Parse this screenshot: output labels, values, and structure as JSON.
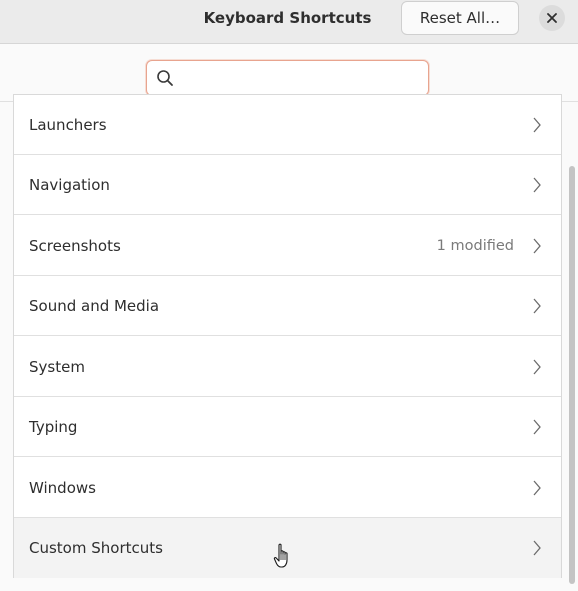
{
  "window": {
    "title": "Keyboard Shortcuts",
    "reset_label": "Reset All…"
  },
  "search": {
    "placeholder": "",
    "value": ""
  },
  "categories": [
    {
      "label": "Launchers",
      "status": ""
    },
    {
      "label": "Navigation",
      "status": ""
    },
    {
      "label": "Screenshots",
      "status": "1 modified"
    },
    {
      "label": "Sound and Media",
      "status": ""
    },
    {
      "label": "System",
      "status": ""
    },
    {
      "label": "Typing",
      "status": ""
    },
    {
      "label": "Windows",
      "status": ""
    },
    {
      "label": "Custom Shortcuts",
      "status": ""
    }
  ],
  "icons": {
    "close": "close-icon",
    "search": "search-icon",
    "chevron": "chevron-right-icon",
    "cursor": "hand-pointer-cursor"
  },
  "colors": {
    "headerbar": "#ebebeb",
    "search_focus_border": "#e8a48f",
    "status_text": "#7a7a7a"
  }
}
